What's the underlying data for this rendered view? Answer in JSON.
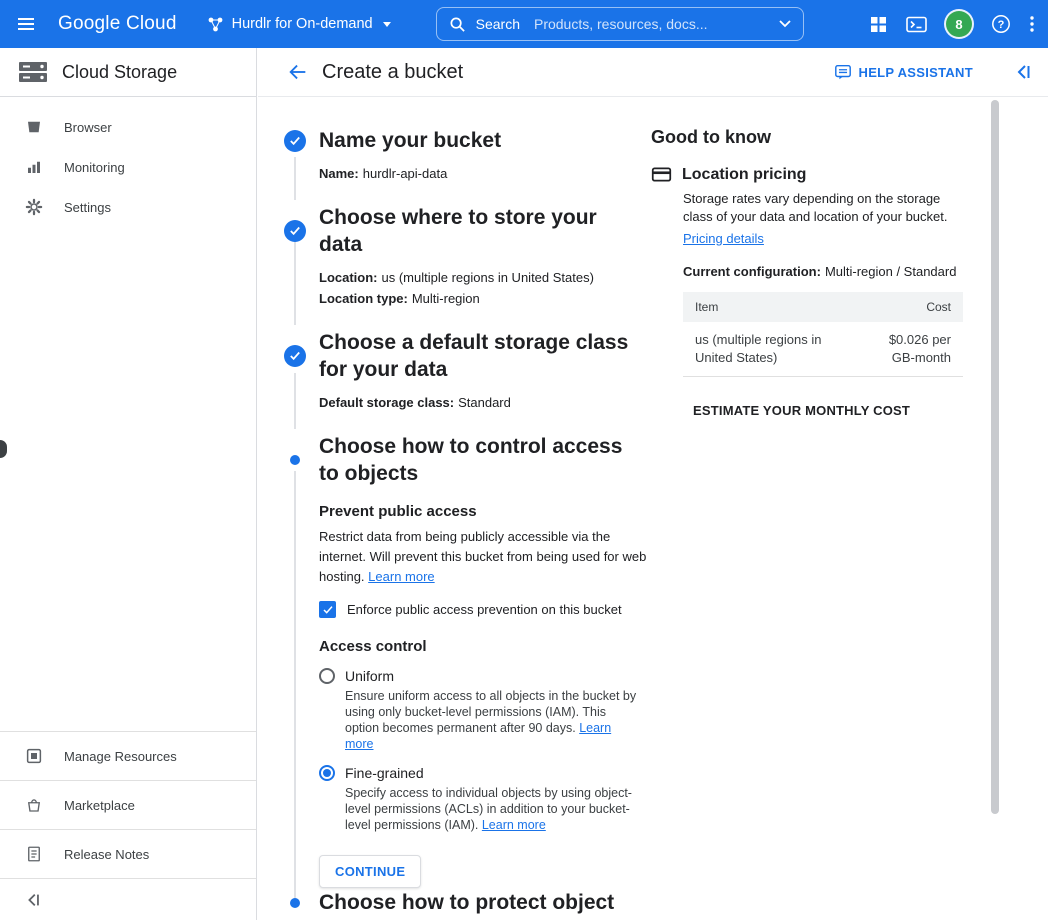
{
  "topbar": {
    "logo": "Google Cloud",
    "project": "Hurdlr for On-demand",
    "search": {
      "label": "Search",
      "placeholder": "Products, resources, docs..."
    },
    "avatar": "8"
  },
  "sidebar": {
    "product": "Cloud Storage",
    "items": [
      {
        "label": "Browser"
      },
      {
        "label": "Monitoring"
      },
      {
        "label": "Settings"
      }
    ],
    "footer_items": [
      {
        "label": "Manage Resources"
      },
      {
        "label": "Marketplace"
      },
      {
        "label": "Release Notes"
      }
    ]
  },
  "header": {
    "title": "Create a bucket",
    "help_assistant": "HELP ASSISTANT"
  },
  "steps": [
    {
      "title": "Name your bucket",
      "state": "done",
      "fields": [
        {
          "label": "Name:",
          "value": "hurdlr-api-data"
        }
      ]
    },
    {
      "title": "Choose where to store your data",
      "state": "done",
      "fields": [
        {
          "label": "Location:",
          "value": "us (multiple regions in United States)"
        },
        {
          "label": "Location type:",
          "value": "Multi-region"
        }
      ]
    },
    {
      "title": "Choose a default storage class for your data",
      "state": "done",
      "fields": [
        {
          "label": "Default storage class:",
          "value": "Standard"
        }
      ]
    },
    {
      "title": "Choose how to control access to objects",
      "state": "active"
    },
    {
      "title": "Choose how to protect object",
      "state": "pending"
    }
  ],
  "access": {
    "prevent": {
      "title": "Prevent public access",
      "description": "Restrict data from being publicly accessible via the internet. Will prevent this bucket from being used for web hosting.",
      "learn_more": "Learn more",
      "checkbox_label": "Enforce public access prevention on this bucket",
      "checkbox_checked": true
    },
    "control": {
      "title": "Access control",
      "options": [
        {
          "label": "Uniform",
          "selected": false,
          "description": "Ensure uniform access to all objects in the bucket by using only bucket-level permissions (IAM). This option becomes permanent after 90 days.",
          "learn_more": "Learn more"
        },
        {
          "label": "Fine-grained",
          "selected": true,
          "description": "Specify access to individual objects by using object-level permissions (ACLs) in addition to your bucket-level permissions (IAM).",
          "learn_more": "Learn more"
        }
      ]
    },
    "continue_label": "CONTINUE"
  },
  "good_to_know": {
    "title": "Good to know",
    "pricing": {
      "title": "Location pricing",
      "description": "Storage rates vary depending on the storage class of your data and location of your bucket.",
      "link": "Pricing details",
      "config_label": "Current configuration:",
      "config_value": "Multi-region / Standard",
      "table": {
        "columns": [
          "Item",
          "Cost"
        ],
        "rows": [
          {
            "item": "us (multiple regions in United States)",
            "cost": "$0.026 per GB-month"
          }
        ]
      },
      "estimate_button": "ESTIMATE YOUR MONTHLY COST"
    }
  },
  "colors": {
    "accent": "#1a73e8",
    "avatar_green": "#34a853",
    "table_header_bg": "#f1f3f4"
  }
}
